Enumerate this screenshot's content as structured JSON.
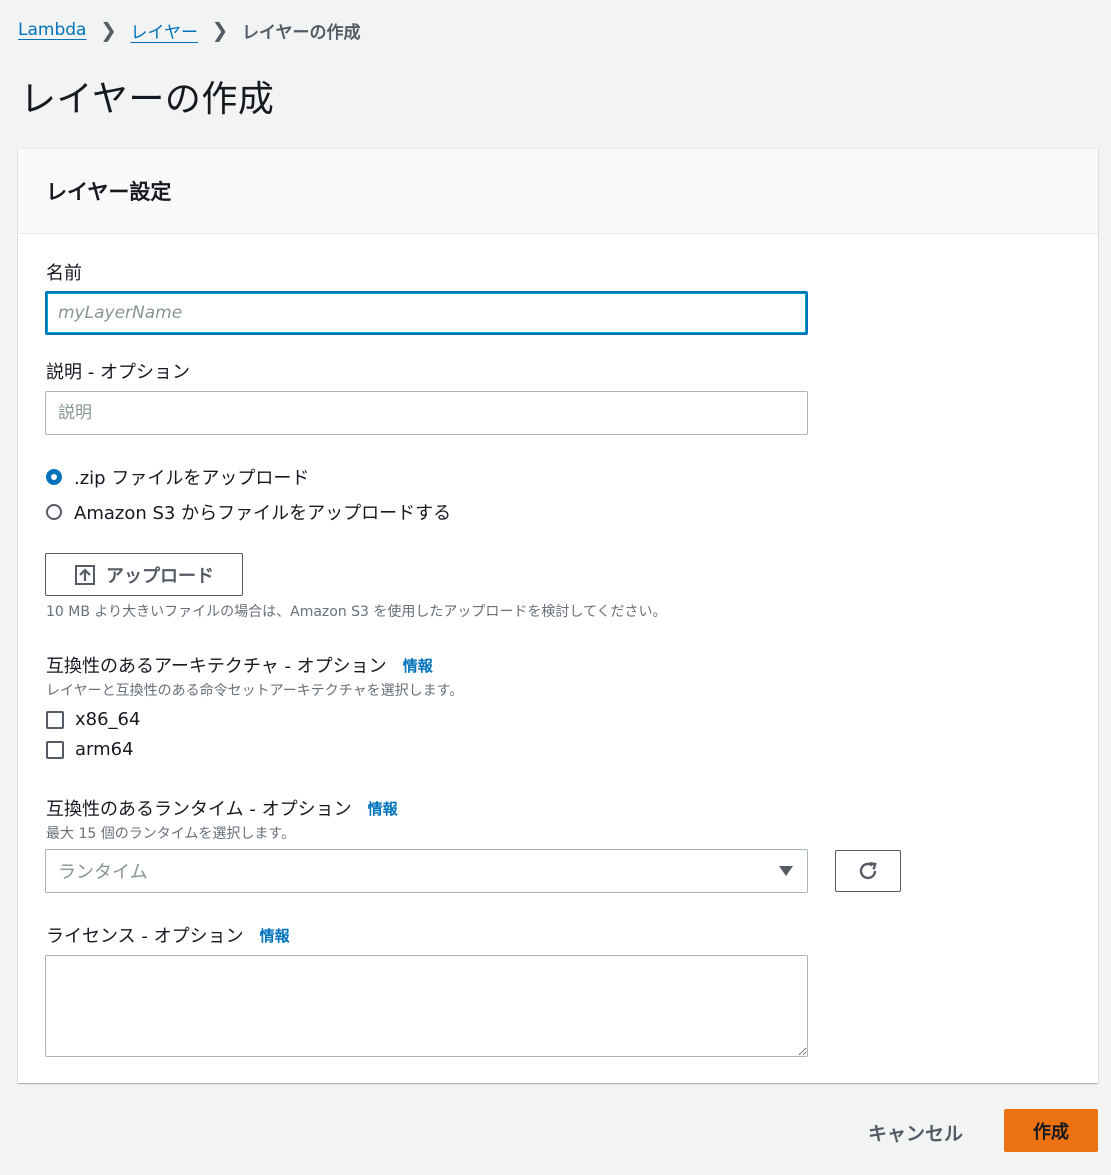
{
  "breadcrumb": {
    "items": [
      "Lambda",
      "レイヤー"
    ],
    "current": "レイヤーの作成"
  },
  "page": {
    "title": "レイヤーの作成"
  },
  "panel": {
    "title": "レイヤー設定"
  },
  "name_field": {
    "label": "名前",
    "placeholder": "myLayerName"
  },
  "description_field": {
    "label": "説明 - オプション",
    "placeholder": "説明"
  },
  "upload_options": [
    {
      "label": ".zip ファイルをアップロード",
      "selected": true
    },
    {
      "label": "Amazon S3 からファイルをアップロードする",
      "selected": false
    }
  ],
  "upload_button": {
    "label": "アップロード",
    "icon": "upload-icon"
  },
  "upload_hint": "10 MB より大きいファイルの場合は、Amazon S3 を使用したアップロードを検討してください。",
  "architectures": {
    "label": "互換性のあるアーキテクチャ - オプション",
    "info": "情報",
    "description": "レイヤーと互換性のある命令セットアーキテクチャを選択します。",
    "options": [
      {
        "label": "x86_64",
        "checked": false
      },
      {
        "label": "arm64",
        "checked": false
      }
    ]
  },
  "runtimes": {
    "label": "互換性のあるランタイム - オプション",
    "info": "情報",
    "description": "最大 15 個のランタイムを選択します。",
    "placeholder": "ランタイム"
  },
  "license": {
    "label": "ライセンス - オプション",
    "info": "情報",
    "value": ""
  },
  "actions": {
    "cancel": "キャンセル",
    "create": "作成"
  },
  "colors": {
    "link": "#0073bb",
    "primary": "#ec7211",
    "background": "#f2f3f3"
  }
}
